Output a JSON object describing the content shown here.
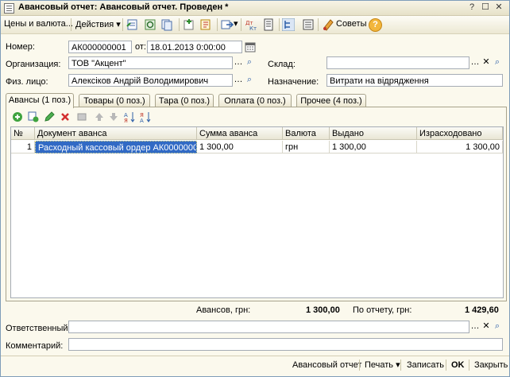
{
  "window": {
    "title": "Авансовый отчет: Авансовый отчет. Проведен *"
  },
  "toolbar": {
    "prices_menu": "Цены и валюта...",
    "actions_menu": "Действия",
    "tips_label": "Советы"
  },
  "form": {
    "number_label": "Номер:",
    "number_value": "АК000000001",
    "from_label": "от:",
    "date_value": "18.01.2013  0:00:00",
    "org_label": "Организация:",
    "org_value": "ТОВ \"Акцент\"",
    "warehouse_label": "Склад:",
    "warehouse_value": "",
    "person_label": "Физ. лицо:",
    "person_value": "Алексіков Андрій Володимирович",
    "purpose_label": "Назначение:",
    "purpose_value": "Витрати на відрядження"
  },
  "tabs": [
    "Авансы (1 поз.)",
    "Товары (0 поз.)",
    "Тара (0 поз.)",
    "Оплата (0 поз.)",
    "Прочее (4 поз.)"
  ],
  "table": {
    "headers": [
      "№",
      "Документ аванса",
      "Сумма аванса",
      "Валюта",
      "Выдано",
      "Израсходовано"
    ],
    "rows": [
      [
        "1",
        "Расходный кассовый ордер АК0000000...",
        "1 300,00",
        "грн",
        "1 300,00",
        "1 300,00"
      ]
    ]
  },
  "totals": {
    "advances_label": "Авансов, грн:",
    "advances_value": "1 300,00",
    "report_label": "По отчету, грн:",
    "report_value": "1 429,60"
  },
  "responsible_label": "Ответственный:",
  "responsible_value": "",
  "comment_label": "Комментарий:",
  "comment_value": "",
  "bottom_buttons": {
    "advance_report": "Авансовый отчет",
    "print": "Печать",
    "save": "Записать",
    "ok": "OK",
    "close": "Закрыть"
  }
}
